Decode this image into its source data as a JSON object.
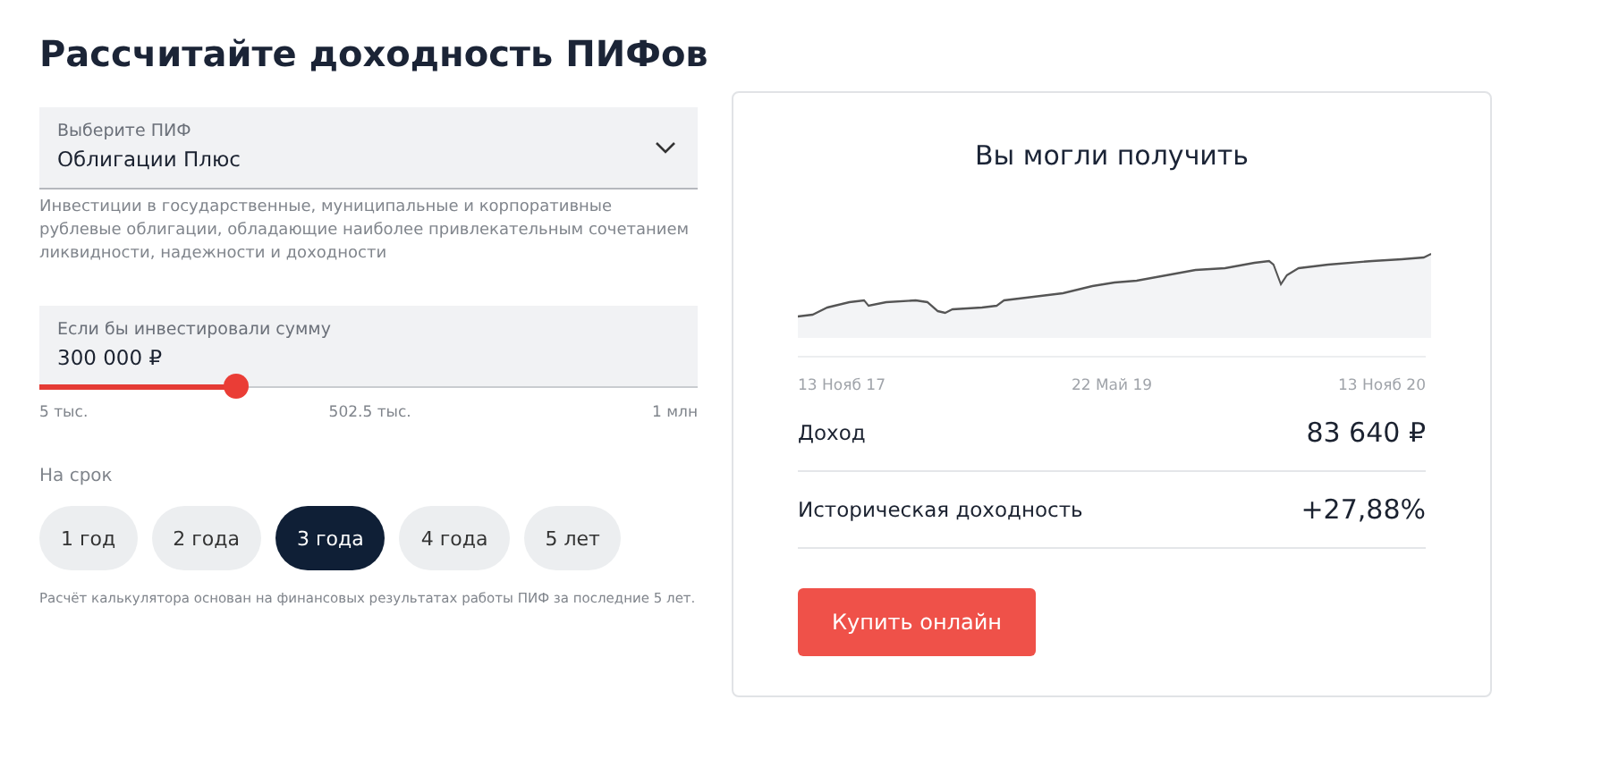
{
  "title": "Рассчитайте доходность ПИФов",
  "fund_select": {
    "label": "Выберите ПИФ",
    "value": "Облигации Плюс"
  },
  "fund_description": "Инвестиции в государственные, муниципальные и корпоративные рублевые облигации, обладающие наиболее привлекательным сочетанием ликвидности, надежности и доходности",
  "amount": {
    "label": "Если бы инвестировали сумму",
    "value": "300 000 ₽",
    "level": 0.3,
    "scale": [
      "5 тыс.",
      "502.5 тыс.",
      "1 млн"
    ]
  },
  "term": {
    "label": "На срок",
    "options": [
      {
        "label": "1 год",
        "selected": false
      },
      {
        "label": "2 года",
        "selected": false
      },
      {
        "label": "3 года",
        "selected": true
      },
      {
        "label": "4 года",
        "selected": false
      },
      {
        "label": "5 лет",
        "selected": false
      }
    ]
  },
  "footnote": "Расчёт калькулятора основан на финансовых результатах работы ПИФ за последние 5 лет.",
  "result": {
    "title": "Вы могли получить",
    "chart_dates": [
      "13 Нояб 17",
      "22 Май 19",
      "13 Нояб 20"
    ],
    "rows": [
      {
        "label": "Доход",
        "value": "83 640 ₽"
      },
      {
        "label": "Историческая доходность",
        "value": "+27,88%"
      }
    ],
    "button": "Купить онлайн"
  }
}
